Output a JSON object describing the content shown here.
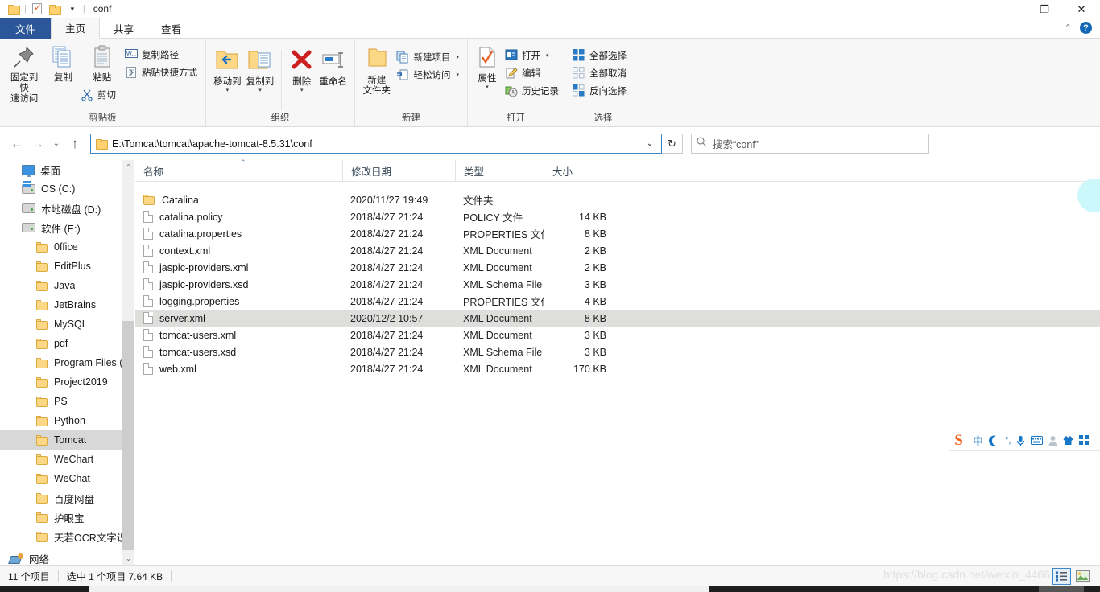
{
  "window": {
    "title": "conf",
    "quick_access": [
      "folder-icon",
      "properties-icon",
      "new-folder-icon",
      "customize-caret"
    ],
    "minimize": "—",
    "maximize": "❐",
    "close": "✕",
    "collapse_ribbon": "⌃",
    "help": "?"
  },
  "tabs": [
    {
      "label": "文件",
      "kind": "file"
    },
    {
      "label": "主页",
      "kind": "active"
    },
    {
      "label": "共享",
      "kind": "normal"
    },
    {
      "label": "查看",
      "kind": "normal"
    }
  ],
  "ribbon": {
    "groups": [
      {
        "name": "clipboard",
        "label": "剪贴板",
        "big": [
          {
            "label1": "固定到快",
            "label2": "速访问",
            "icon": "pin-icon"
          },
          {
            "label1": "复制",
            "label2": "",
            "icon": "copy-icon"
          },
          {
            "label1": "粘贴",
            "label2": "",
            "icon": "paste-icon"
          }
        ],
        "small": [
          {
            "label": "复制路径",
            "icon": "copy-path-icon"
          },
          {
            "label": "粘贴快捷方式",
            "icon": "paste-shortcut-icon"
          }
        ],
        "cut_label": "剪切"
      },
      {
        "name": "organize",
        "label": "组织",
        "big": [
          {
            "label1": "移动到",
            "label2": "",
            "icon": "move-to-icon",
            "dropdown": true
          },
          {
            "label1": "复制到",
            "label2": "",
            "icon": "copy-to-icon",
            "dropdown": true
          },
          {
            "label1": "删除",
            "label2": "",
            "icon": "delete-icon",
            "dropdown": true
          },
          {
            "label1": "重命名",
            "label2": "",
            "icon": "rename-icon"
          }
        ]
      },
      {
        "name": "new",
        "label": "新建",
        "big": [
          {
            "label1": "新建",
            "label2": "文件夹",
            "icon": "new-folder-icon"
          }
        ],
        "small": [
          {
            "label": "新建项目",
            "icon": "new-item-icon",
            "dropdown": true
          },
          {
            "label": "轻松访问",
            "icon": "easy-access-icon",
            "dropdown": true
          }
        ]
      },
      {
        "name": "open",
        "label": "打开",
        "big": [
          {
            "label1": "属性",
            "label2": "",
            "icon": "properties-icon",
            "dropdown": true
          }
        ],
        "small": [
          {
            "label": "打开",
            "icon": "open-icon",
            "dropdown": true
          },
          {
            "label": "编辑",
            "icon": "edit-icon"
          },
          {
            "label": "历史记录",
            "icon": "history-icon"
          }
        ]
      },
      {
        "name": "select",
        "label": "选择",
        "small": [
          {
            "label": "全部选择",
            "icon": "select-all-icon"
          },
          {
            "label": "全部取消",
            "icon": "select-none-icon"
          },
          {
            "label": "反向选择",
            "icon": "invert-selection-icon"
          }
        ]
      }
    ]
  },
  "addressbar": {
    "back": "←",
    "forward": "→",
    "recent": "⌄",
    "up": "↑",
    "path": "E:\\Tomcat\\tomcat\\apache-tomcat-8.5.31\\conf",
    "dropdown": "⌄",
    "refresh": "↻"
  },
  "search": {
    "placeholder": "搜索“conf”",
    "icon": "search-icon"
  },
  "navpane": {
    "items": [
      {
        "label": "桌面",
        "icon": "desktop-icon",
        "level": 0,
        "selected": false
      },
      {
        "label": "OS (C:)",
        "icon": "drive-os-icon",
        "level": 0,
        "selected": false
      },
      {
        "label": "本地磁盘 (D:)",
        "icon": "drive-icon",
        "level": 0,
        "selected": false
      },
      {
        "label": "软件 (E:)",
        "icon": "drive-icon",
        "level": 0,
        "selected": false
      },
      {
        "label": "0ffice",
        "icon": "folder-icon",
        "level": 1,
        "selected": false
      },
      {
        "label": "EditPlus",
        "icon": "folder-icon",
        "level": 1,
        "selected": false
      },
      {
        "label": "Java",
        "icon": "folder-icon",
        "level": 1,
        "selected": false
      },
      {
        "label": "JetBrains",
        "icon": "folder-icon",
        "level": 1,
        "selected": false
      },
      {
        "label": "MySQL",
        "icon": "folder-icon",
        "level": 1,
        "selected": false
      },
      {
        "label": "pdf",
        "icon": "folder-icon",
        "level": 1,
        "selected": false
      },
      {
        "label": "Program Files (x",
        "icon": "folder-icon",
        "level": 1,
        "selected": false
      },
      {
        "label": "Project2019",
        "icon": "folder-icon",
        "level": 1,
        "selected": false
      },
      {
        "label": "PS",
        "icon": "folder-icon",
        "level": 1,
        "selected": false
      },
      {
        "label": "Python",
        "icon": "folder-icon",
        "level": 1,
        "selected": false
      },
      {
        "label": "Tomcat",
        "icon": "folder-icon",
        "level": 1,
        "selected": true
      },
      {
        "label": "WeChart",
        "icon": "folder-icon",
        "level": 1,
        "selected": false
      },
      {
        "label": "WeChat",
        "icon": "folder-icon",
        "level": 1,
        "selected": false
      },
      {
        "label": "百度网盘",
        "icon": "folder-icon",
        "level": 1,
        "selected": false
      },
      {
        "label": "护眼宝",
        "icon": "folder-icon",
        "level": 1,
        "selected": false
      },
      {
        "label": "天若OCR文字识别",
        "icon": "folder-icon",
        "level": 1,
        "selected": false
      },
      {
        "label": "网络",
        "icon": "network-icon",
        "level": -1,
        "selected": false
      }
    ],
    "scroll_up": "⌃",
    "scroll_down": "⌄"
  },
  "filelist": {
    "columns": [
      {
        "label": "名称",
        "key": "name"
      },
      {
        "label": "修改日期",
        "key": "date"
      },
      {
        "label": "类型",
        "key": "type"
      },
      {
        "label": "大小",
        "key": "size"
      }
    ],
    "sort_indicator": "⌃",
    "rows": [
      {
        "name": "Catalina",
        "date": "2020/11/27 19:49",
        "type": "文件夹",
        "size": "",
        "icon": "folder-icon",
        "selected": false
      },
      {
        "name": "catalina.policy",
        "date": "2018/4/27 21:24",
        "type": "POLICY 文件",
        "size": "14 KB",
        "icon": "file-icon",
        "selected": false
      },
      {
        "name": "catalina.properties",
        "date": "2018/4/27 21:24",
        "type": "PROPERTIES 文件",
        "size": "8 KB",
        "icon": "file-icon",
        "selected": false
      },
      {
        "name": "context.xml",
        "date": "2018/4/27 21:24",
        "type": "XML Document",
        "size": "2 KB",
        "icon": "file-icon",
        "selected": false
      },
      {
        "name": "jaspic-providers.xml",
        "date": "2018/4/27 21:24",
        "type": "XML Document",
        "size": "2 KB",
        "icon": "file-icon",
        "selected": false
      },
      {
        "name": "jaspic-providers.xsd",
        "date": "2018/4/27 21:24",
        "type": "XML Schema File",
        "size": "3 KB",
        "icon": "file-icon",
        "selected": false
      },
      {
        "name": "logging.properties",
        "date": "2018/4/27 21:24",
        "type": "PROPERTIES 文件",
        "size": "4 KB",
        "icon": "file-icon",
        "selected": false
      },
      {
        "name": "server.xml",
        "date": "2020/12/2 10:57",
        "type": "XML Document",
        "size": "8 KB",
        "icon": "file-icon",
        "selected": true
      },
      {
        "name": "tomcat-users.xml",
        "date": "2018/4/27 21:24",
        "type": "XML Document",
        "size": "3 KB",
        "icon": "file-icon",
        "selected": false
      },
      {
        "name": "tomcat-users.xsd",
        "date": "2018/4/27 21:24",
        "type": "XML Schema File",
        "size": "3 KB",
        "icon": "file-icon",
        "selected": false
      },
      {
        "name": "web.xml",
        "date": "2018/4/27 21:24",
        "type": "XML Document",
        "size": "170 KB",
        "icon": "file-icon",
        "selected": false
      }
    ]
  },
  "ime": {
    "items": [
      "sogou-logo-icon",
      "chinese-mode-icon",
      "moon-icon",
      "fullwidth-icon",
      "microphone-icon",
      "keyboard-icon",
      "user-icon",
      "skin-icon",
      "toolbox-icon"
    ],
    "chinese_label": "中",
    "moon_label": "☾",
    "punctuation_label": "°,",
    "mic_label": "🎤",
    "keyboard_label": "⌨",
    "user_label": "♟",
    "skin_label": "👕",
    "box_label": "▦"
  },
  "statusbar": {
    "item_count": "11 个项目",
    "selection": "选中 1 个项目  7.64 KB",
    "view_details": "details-view-icon",
    "view_large": "large-icons-view-icon"
  },
  "watermark": {
    "text": "https://blog.csdn.net/weixin_4466"
  },
  "colors": {
    "file_tab_blue": "#2b579a",
    "accent_blue": "#3e86c8",
    "selection_grey": "#dededd",
    "folder_yellow": "#fbd786"
  }
}
